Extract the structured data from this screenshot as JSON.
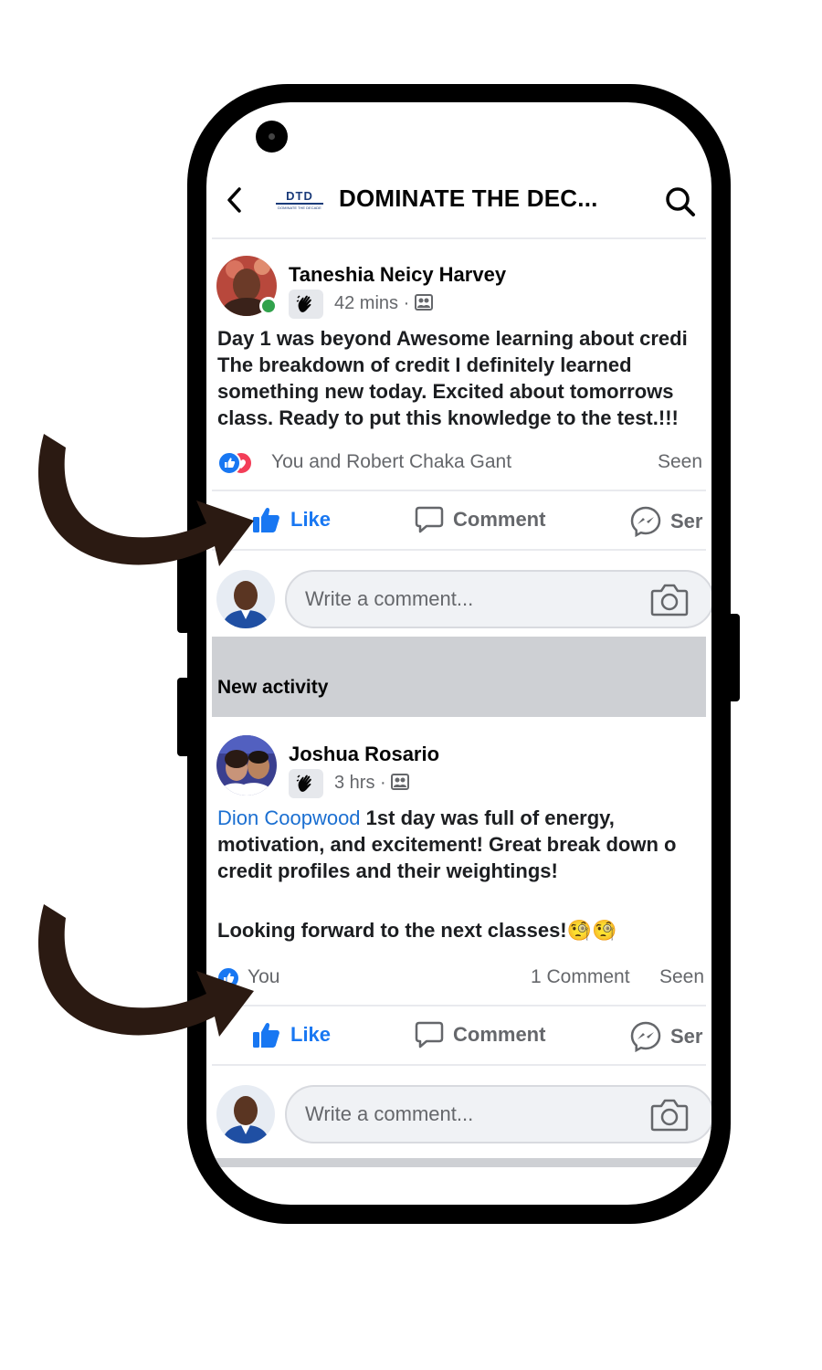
{
  "header": {
    "title": "DOMINATE THE DEC...",
    "logo_text": "DTD",
    "logo_subtext": "DOMINATE THE DECADE"
  },
  "posts": [
    {
      "author": "Taneshia Neicy Harvey",
      "time": "42 mins",
      "separator": "·",
      "lines": [
        "Day 1 was beyond Awesome learning about credi",
        "The breakdown of credit I definitely learned",
        "something new today. Excited about tomorrows",
        "class. Ready to put this knowledge to the test.!!!"
      ],
      "reactions_text": "You and Robert Chaka Gant",
      "seen_label": "Seen",
      "comments_count": ""
    },
    {
      "author": "Joshua Rosario",
      "time": "3 hrs",
      "separator": "·",
      "mention": "Dion Coopwood",
      "line1_rest": " 1st day was full of energy,",
      "lines": [
        "motivation, and excitement! Great break down o",
        "credit profiles and their weightings!",
        "Looking forward to the next classes!"
      ],
      "emojis": "🧐🧐",
      "reactions_text": "You",
      "seen_label": "Seen",
      "comments_count": "1 Comment"
    }
  ],
  "actions": {
    "like": "Like",
    "comment": "Comment",
    "send": "Ser"
  },
  "comment_input": {
    "placeholder": "Write a comment..."
  },
  "section": {
    "label": "New activity"
  },
  "colors": {
    "like_blue": "#1877f2",
    "mention_blue": "#1b6fd1",
    "online_green": "#31a24c",
    "arrow_brown": "#2b1a12",
    "section_gray": "#ced0d4"
  }
}
